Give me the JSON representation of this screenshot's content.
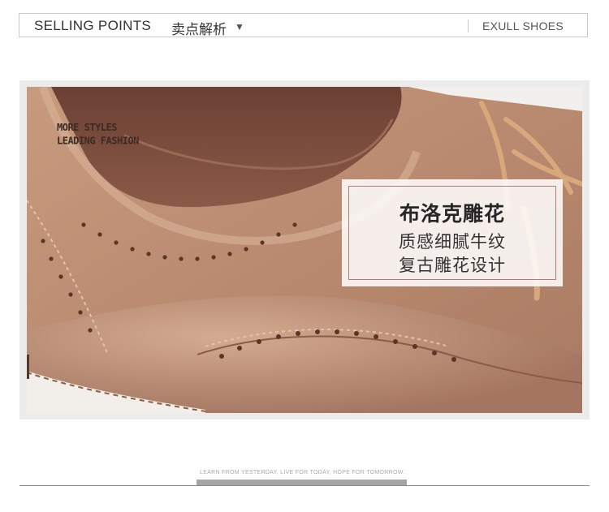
{
  "header": {
    "title": "SELLING POINTS",
    "subtitle": "卖点解析",
    "arrow": "▼",
    "brand": "EXULL SHOES"
  },
  "photo": {
    "watermark_line1": "MORE STYLES",
    "watermark_line2": "LEADING FASHION"
  },
  "feature_card": {
    "title": "布洛克雕花",
    "line1": "质感细腻牛纹",
    "line2": "复古雕花设计"
  },
  "footer": {
    "slogan": "LEARN FROM YESTERDAY, LIVE FOR TODAY, HOPE FOR TOMORROW."
  },
  "colors": {
    "leather": "#b88a70",
    "border": "#c9c9c9",
    "card_border": "#b07c74"
  }
}
